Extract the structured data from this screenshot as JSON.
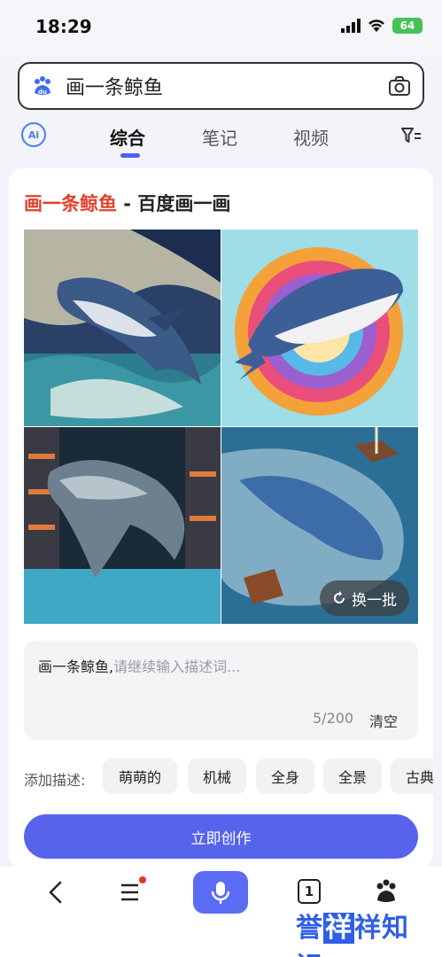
{
  "status_bar": {
    "time": "18:29",
    "battery": "64"
  },
  "search": {
    "query": "画一条鲸鱼"
  },
  "tabs": [
    {
      "label": "综合",
      "active": true
    },
    {
      "label": "笔记",
      "active": false
    },
    {
      "label": "视频",
      "active": false
    }
  ],
  "result_card": {
    "title_highlight": "画一条鲸鱼",
    "title_rest": " - 百度画一画",
    "refresh_label": "换一批",
    "prompt": {
      "text": "画一条鲸鱼,",
      "placeholder": "请继续输入描述词...",
      "counter": "5/200",
      "clear_label": "清空"
    },
    "tags_label": "添加描述:",
    "tags": [
      "萌萌的",
      "机械",
      "全身",
      "全景",
      "古典"
    ],
    "create_label": "立即创作"
  },
  "bottom_nav": {
    "tab_count": "1"
  },
  "watermark": {
    "text_a": "誉",
    "text_b": "祥",
    "text_c": "祥知识"
  },
  "colors": {
    "accent": "#5763ec",
    "highlight": "#e0412c",
    "indicator": "#4a62ee"
  },
  "icons": [
    "baidu-paw-icon",
    "camera-icon",
    "ai-icon",
    "filter-icon",
    "refresh-icon",
    "back-icon",
    "menu-icon",
    "microphone-icon",
    "tabs-icon",
    "paw-icon"
  ]
}
